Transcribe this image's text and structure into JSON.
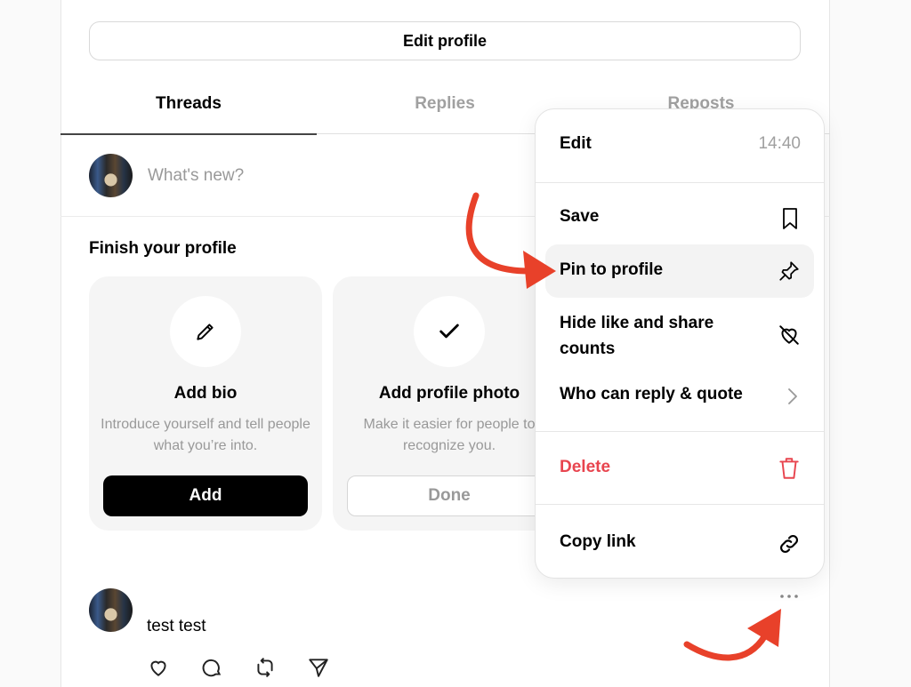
{
  "profile": {
    "edit_profile_label": "Edit profile"
  },
  "tabs": [
    {
      "label": "Threads",
      "active": true
    },
    {
      "label": "Replies",
      "active": false
    },
    {
      "label": "Reposts",
      "active": false
    }
  ],
  "composer": {
    "placeholder": "What's new?"
  },
  "finish_profile": {
    "title": "Finish your profile",
    "cards": [
      {
        "icon": "pencil-icon",
        "title": "Add bio",
        "description": "Introduce yourself and tell people what you’re into.",
        "button": "Add",
        "done": false
      },
      {
        "icon": "checkmark-icon",
        "title": "Add profile photo",
        "description": "Make it easier for people to recognize you.",
        "button": "Done",
        "done": true
      }
    ]
  },
  "post": {
    "text": "test test",
    "actions": [
      "heart-icon",
      "comment-icon",
      "repost-icon",
      "share-icon"
    ],
    "more_icon": "more-horizontal-icon"
  },
  "menu": {
    "items": [
      {
        "label": "Edit",
        "meta": "14:40"
      },
      {
        "label": "Save",
        "icon": "bookmark-icon"
      },
      {
        "label": "Pin to profile",
        "icon": "pin-icon",
        "highlighted": true
      },
      {
        "label": "Hide like and share counts",
        "icon": "heart-off-icon"
      },
      {
        "label": "Who can reply & quote",
        "icon": "chevron-right-icon"
      },
      {
        "label": "Delete",
        "icon": "trash-icon",
        "destructive": true
      },
      {
        "label": "Copy link",
        "icon": "link-icon"
      }
    ]
  },
  "colors": {
    "destructive": "#e8454f",
    "annotation_arrow": "#e8412a"
  }
}
